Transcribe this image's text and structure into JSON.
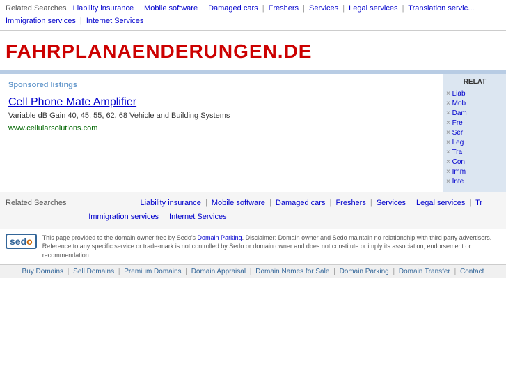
{
  "topBar": {
    "label": "Related Searches",
    "links": [
      "Liability insurance",
      "Mobile software",
      "Damaged cars",
      "Freshers",
      "Services",
      "Legal services",
      "Translation services",
      "Immigration services",
      "Internet Services"
    ]
  },
  "domain": {
    "title": "FAHRPLANAENDERUNGEN.DE"
  },
  "sponsored": {
    "label": "Sponsored listings",
    "listing": {
      "title": "Cell Phone Mate Amplifier",
      "description": "Variable dB Gain 40, 45, 55, 62, 68 Vehicle and Building Systems",
      "url": "www.cellularsolutions.com"
    }
  },
  "sidebar": {
    "title": "RELAT",
    "items": [
      "Liab",
      "Mob",
      "Dam",
      "Fre",
      "Ser",
      "Leg",
      "Tra",
      "Con",
      "Imm",
      "Inte"
    ]
  },
  "bottomRelated": {
    "label": "Related Searches",
    "links": [
      "Liability insurance",
      "Mobile software",
      "Damaged cars",
      "Freshers",
      "Services",
      "Legal services",
      "Tr",
      "Immigration services",
      "Internet Services"
    ]
  },
  "footer": {
    "logo": "sedo",
    "logoAccent": "o",
    "text": "This page provided to the domain owner free by Sedo's ",
    "linkText": "Domain Parking",
    "disclaimer": ". Disclaimer: Domain owner and Sedo maintain no relationship with third party advertisers. Reference to any specific service or trade-mark is not controlled by Sedo or domain owner and does not constitute or imply its association, endorsement or recommendation."
  },
  "bottomNav": {
    "links": [
      "Buy Domains",
      "Sell Domains",
      "Premium Domains",
      "Domain Appraisal",
      "Domain Names for Sale",
      "Domain Parking",
      "Domain Transfer",
      "Contact"
    ]
  }
}
